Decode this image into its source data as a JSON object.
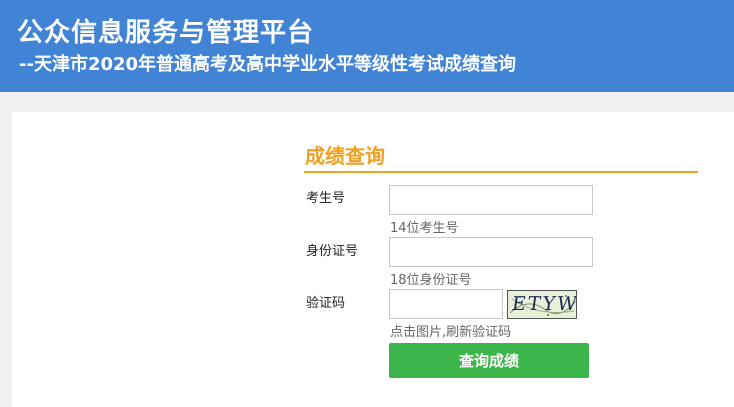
{
  "header": {
    "title": "公众信息服务与管理平台",
    "subtitle": "--天津市2020年普通高考及高中学业水平等级性考试成绩查询",
    "bg_color": "#4184d6"
  },
  "form": {
    "title": "成绩查询",
    "accent_color": "#f0a01c",
    "exam_number": {
      "label": "考生号",
      "value": "",
      "hint": "14位考生号"
    },
    "id_number": {
      "label": "身份证号",
      "value": "",
      "hint": "18位身份证号"
    },
    "captcha": {
      "label": "验证码",
      "value": "",
      "image_text": "ETYW",
      "hint": "点击图片,刷新验证码"
    },
    "submit_label": "查询成绩",
    "submit_color": "#3cb54a"
  }
}
